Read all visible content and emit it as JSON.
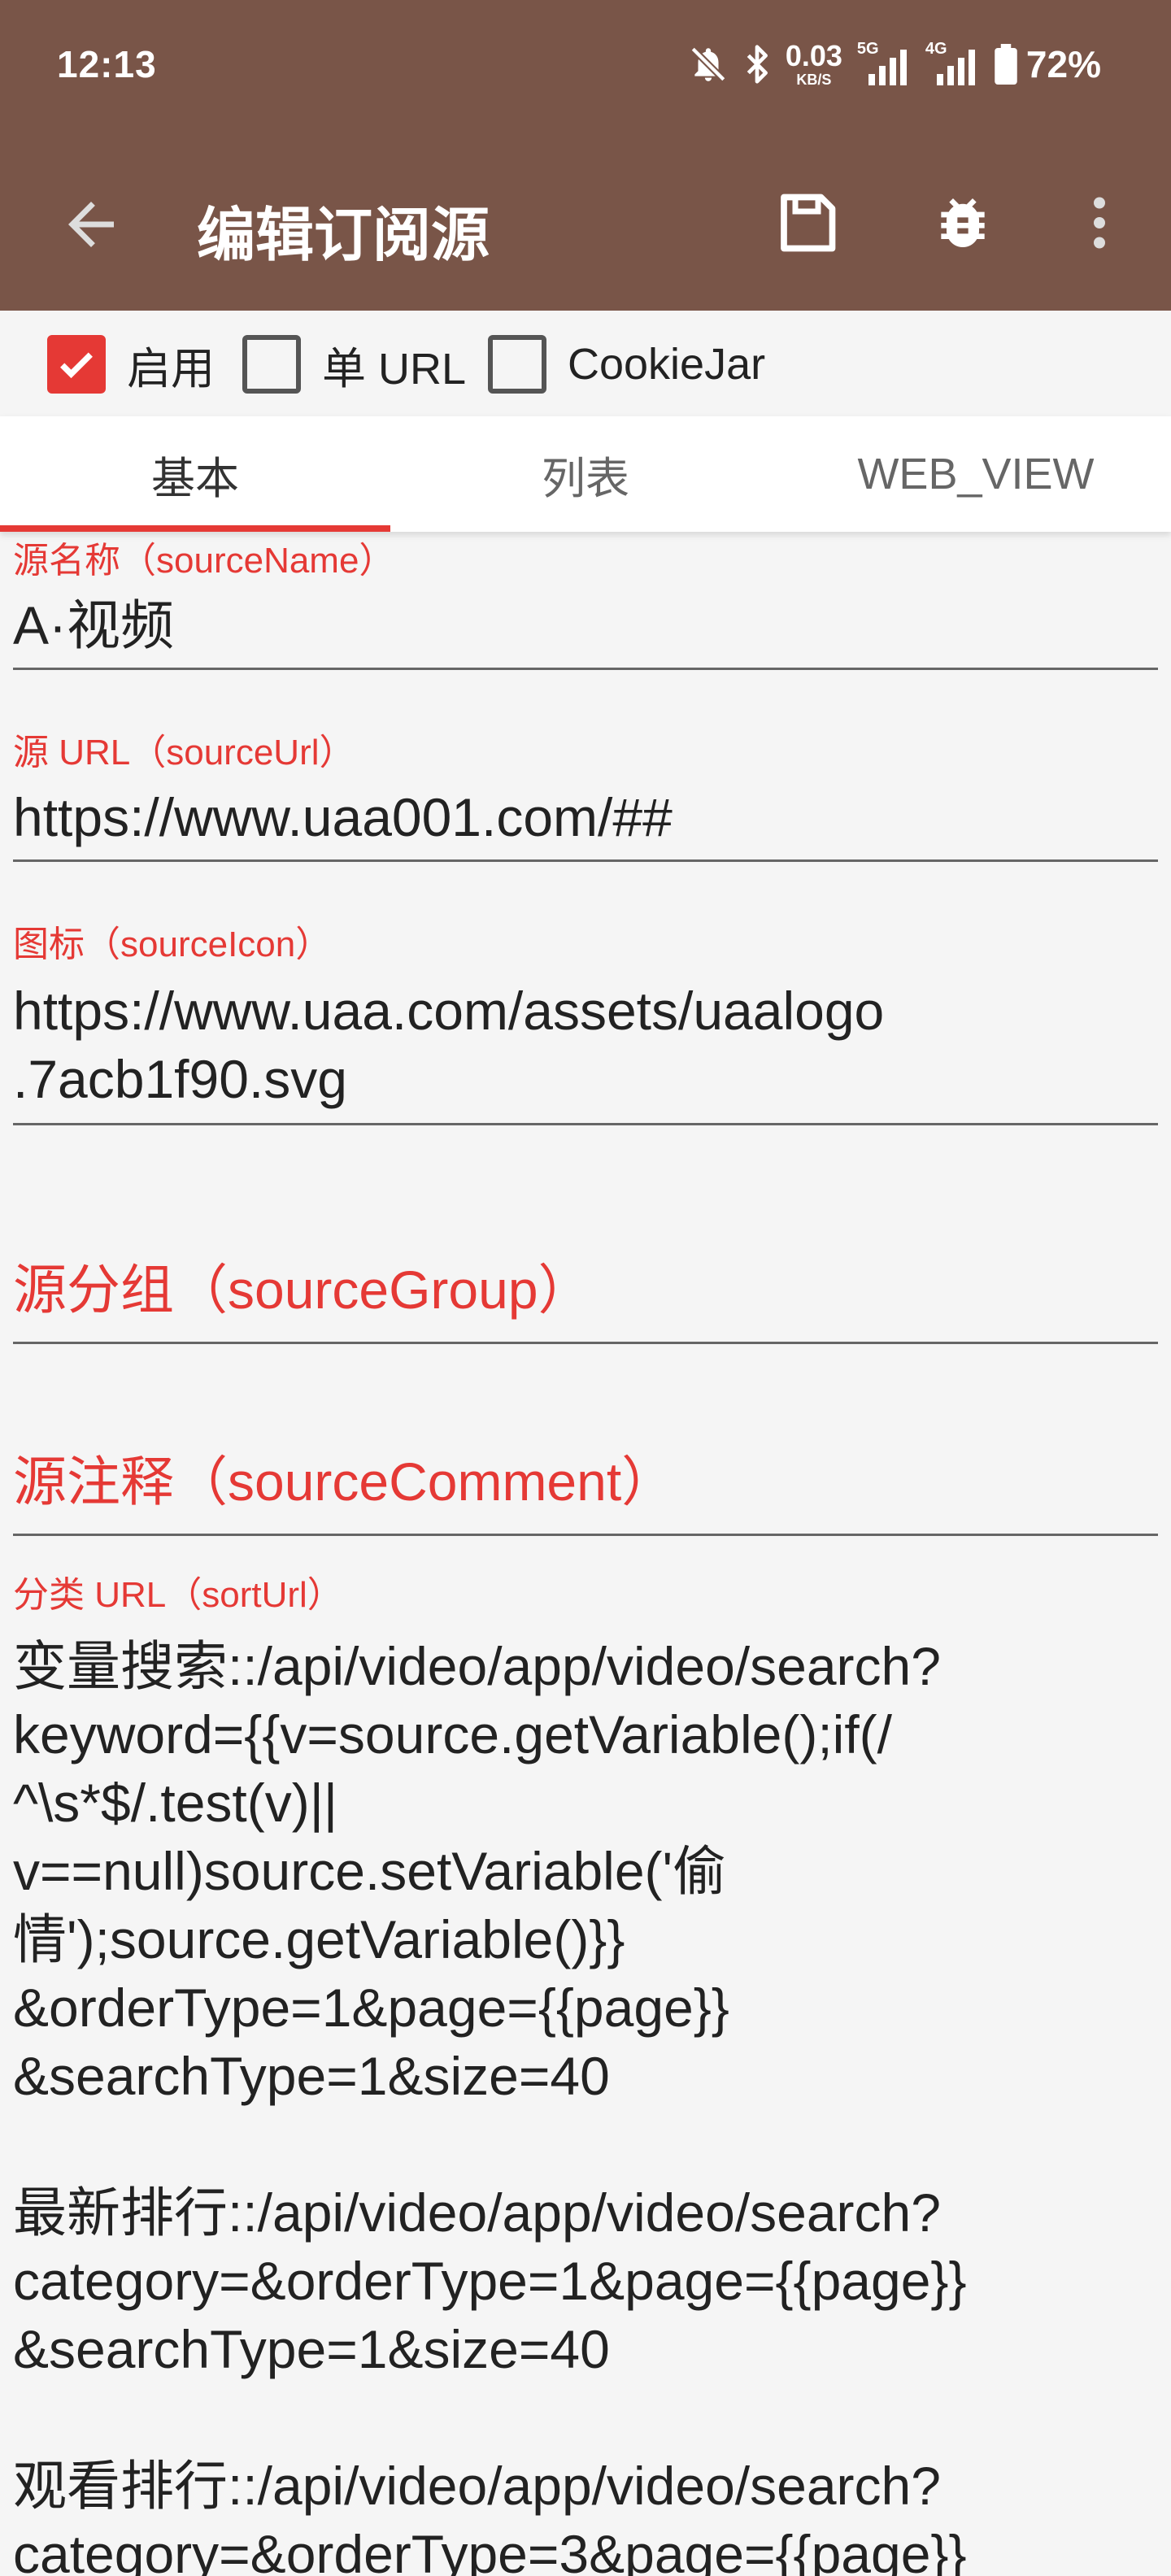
{
  "status_bar": {
    "time": "12:13",
    "speed_value": "0.03",
    "speed_unit": "KB/S",
    "net1_label": "5G",
    "net2_label": "4G",
    "battery": "72%",
    "icons": [
      "mute-icon",
      "bluetooth-icon",
      "signal-icon",
      "battery-icon"
    ]
  },
  "toolbar": {
    "title": "编辑订阅源",
    "actions": [
      "back-arrow-icon",
      "save-icon",
      "debug-bug-icon",
      "more-vert-icon"
    ]
  },
  "options": {
    "enabled_label": "启用",
    "enabled_checked": true,
    "single_url_label": "单 URL",
    "single_url_checked": false,
    "cookiejar_label": "CookieJar",
    "cookiejar_checked": false
  },
  "tabs": [
    {
      "label": "基本",
      "active": true
    },
    {
      "label": "列表",
      "active": false
    },
    {
      "label": "WEB_VIEW",
      "active": false
    }
  ],
  "fields": {
    "source_name": {
      "label": "源名称（sourceName）",
      "value": "A·视频"
    },
    "source_url": {
      "label": "源 URL（sourceUrl）",
      "value": "https://www.uaa001.com/##"
    },
    "source_icon": {
      "label": "图标（sourceIcon）",
      "value": "https://www.uaa.com/assets/uaalogo\n.7acb1f90.svg"
    },
    "source_group": {
      "hint": "源分组（sourceGroup）"
    },
    "source_comment": {
      "hint": "源注释（sourceComment）"
    },
    "sort_url": {
      "label": "分类 URL（sortUrl）",
      "value": "变量搜索::/api/video/app/video/search?\nkeyword={{v=source.getVariable();if(/\n^\\s*$/.test(v)||\nv==null)source.setVariable('偷\n情');source.getVariable()}}\n&orderType=1&page={{page}}\n&searchType=1&size=40\n\n最新排行::/api/video/app/video/search?\ncategory=&orderType=1&page={{page}}\n&searchType=1&size=40\n\n观看排行::/api/video/app/video/search?\ncategory=&orderType=3&page={{page}}"
    }
  },
  "colors": {
    "appbar": "#795548",
    "accent": "#e53935",
    "background": "#f5f5f5"
  }
}
